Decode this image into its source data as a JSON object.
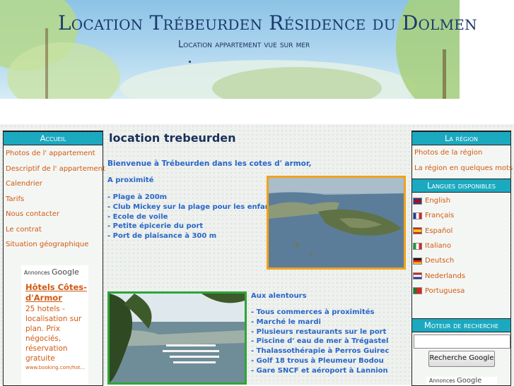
{
  "header": {
    "title": "Location Trébeurden Résidence du Dolmen",
    "subtitle": "Location appartement vue sur mer"
  },
  "left_sidebar": {
    "heading": "Accueil",
    "links": [
      "Photos de l' appartement",
      "Descriptif de l' appartement",
      "Calendrier",
      "Tarifs",
      "Nous contacter",
      "Le contrat",
      "Situation géographique"
    ],
    "ad": {
      "header_label": "Annonces",
      "header_brand": "Google",
      "title": "Hôtels Côtes-d'Armor",
      "text": "25 hotels - localisation sur plan. Prix négociés, réservation gratuite",
      "url": "www.booking.com/hot..."
    }
  },
  "main": {
    "title": "location trebeurden",
    "welcome": "Bienvenue à Trébeurden dans les cotes d' armor,",
    "nearby_heading": "A proximité",
    "nearby_items": [
      "- Plage à 200m",
      "- Club Mickey sur la plage pour les enfants",
      "- Ecole de voile",
      "- Petite épicerie du port",
      "- Port de plaisance à 300 m"
    ],
    "surroundings_heading": "Aux alentours",
    "surroundings_items": [
      "- Tous commerces à proximités",
      "- Marché le mardi",
      "- Plusieurs restaurants sur le port",
      "- Piscine d' eau de mer à Trégastel",
      "- Thalassothérapie à Perros Guirec",
      "- Golf 18 trous à Pleumeur Bodou",
      "- Gare SNCF et aéroport à Lannion"
    ]
  },
  "right_sidebar": {
    "region_heading": "La région",
    "region_links": [
      "Photos de la région",
      "La région en quelques mots"
    ],
    "languages_heading": "Langues disponibles",
    "languages": [
      {
        "label": "English",
        "flag": "uk-flag-icon"
      },
      {
        "label": "Français",
        "flag": "fr-flag-icon"
      },
      {
        "label": "Español",
        "flag": "es-flag-icon"
      },
      {
        "label": "Italiano",
        "flag": "it-flag-icon"
      },
      {
        "label": "Deutsch",
        "flag": "de-flag-icon"
      },
      {
        "label": "Nederlands",
        "flag": "nl-flag-icon"
      },
      {
        "label": "Portuguesa",
        "flag": "pt-flag-icon"
      }
    ],
    "search_heading": "Moteur de recherche",
    "search_value": "",
    "search_button": "Recherche Google",
    "ad_header_label": "Annonces",
    "ad_header_brand": "Google"
  },
  "colors": {
    "accent": "#1ba9c0",
    "link": "#d05a10",
    "body_text": "#2a66c8",
    "title": "#1b2f5a"
  }
}
